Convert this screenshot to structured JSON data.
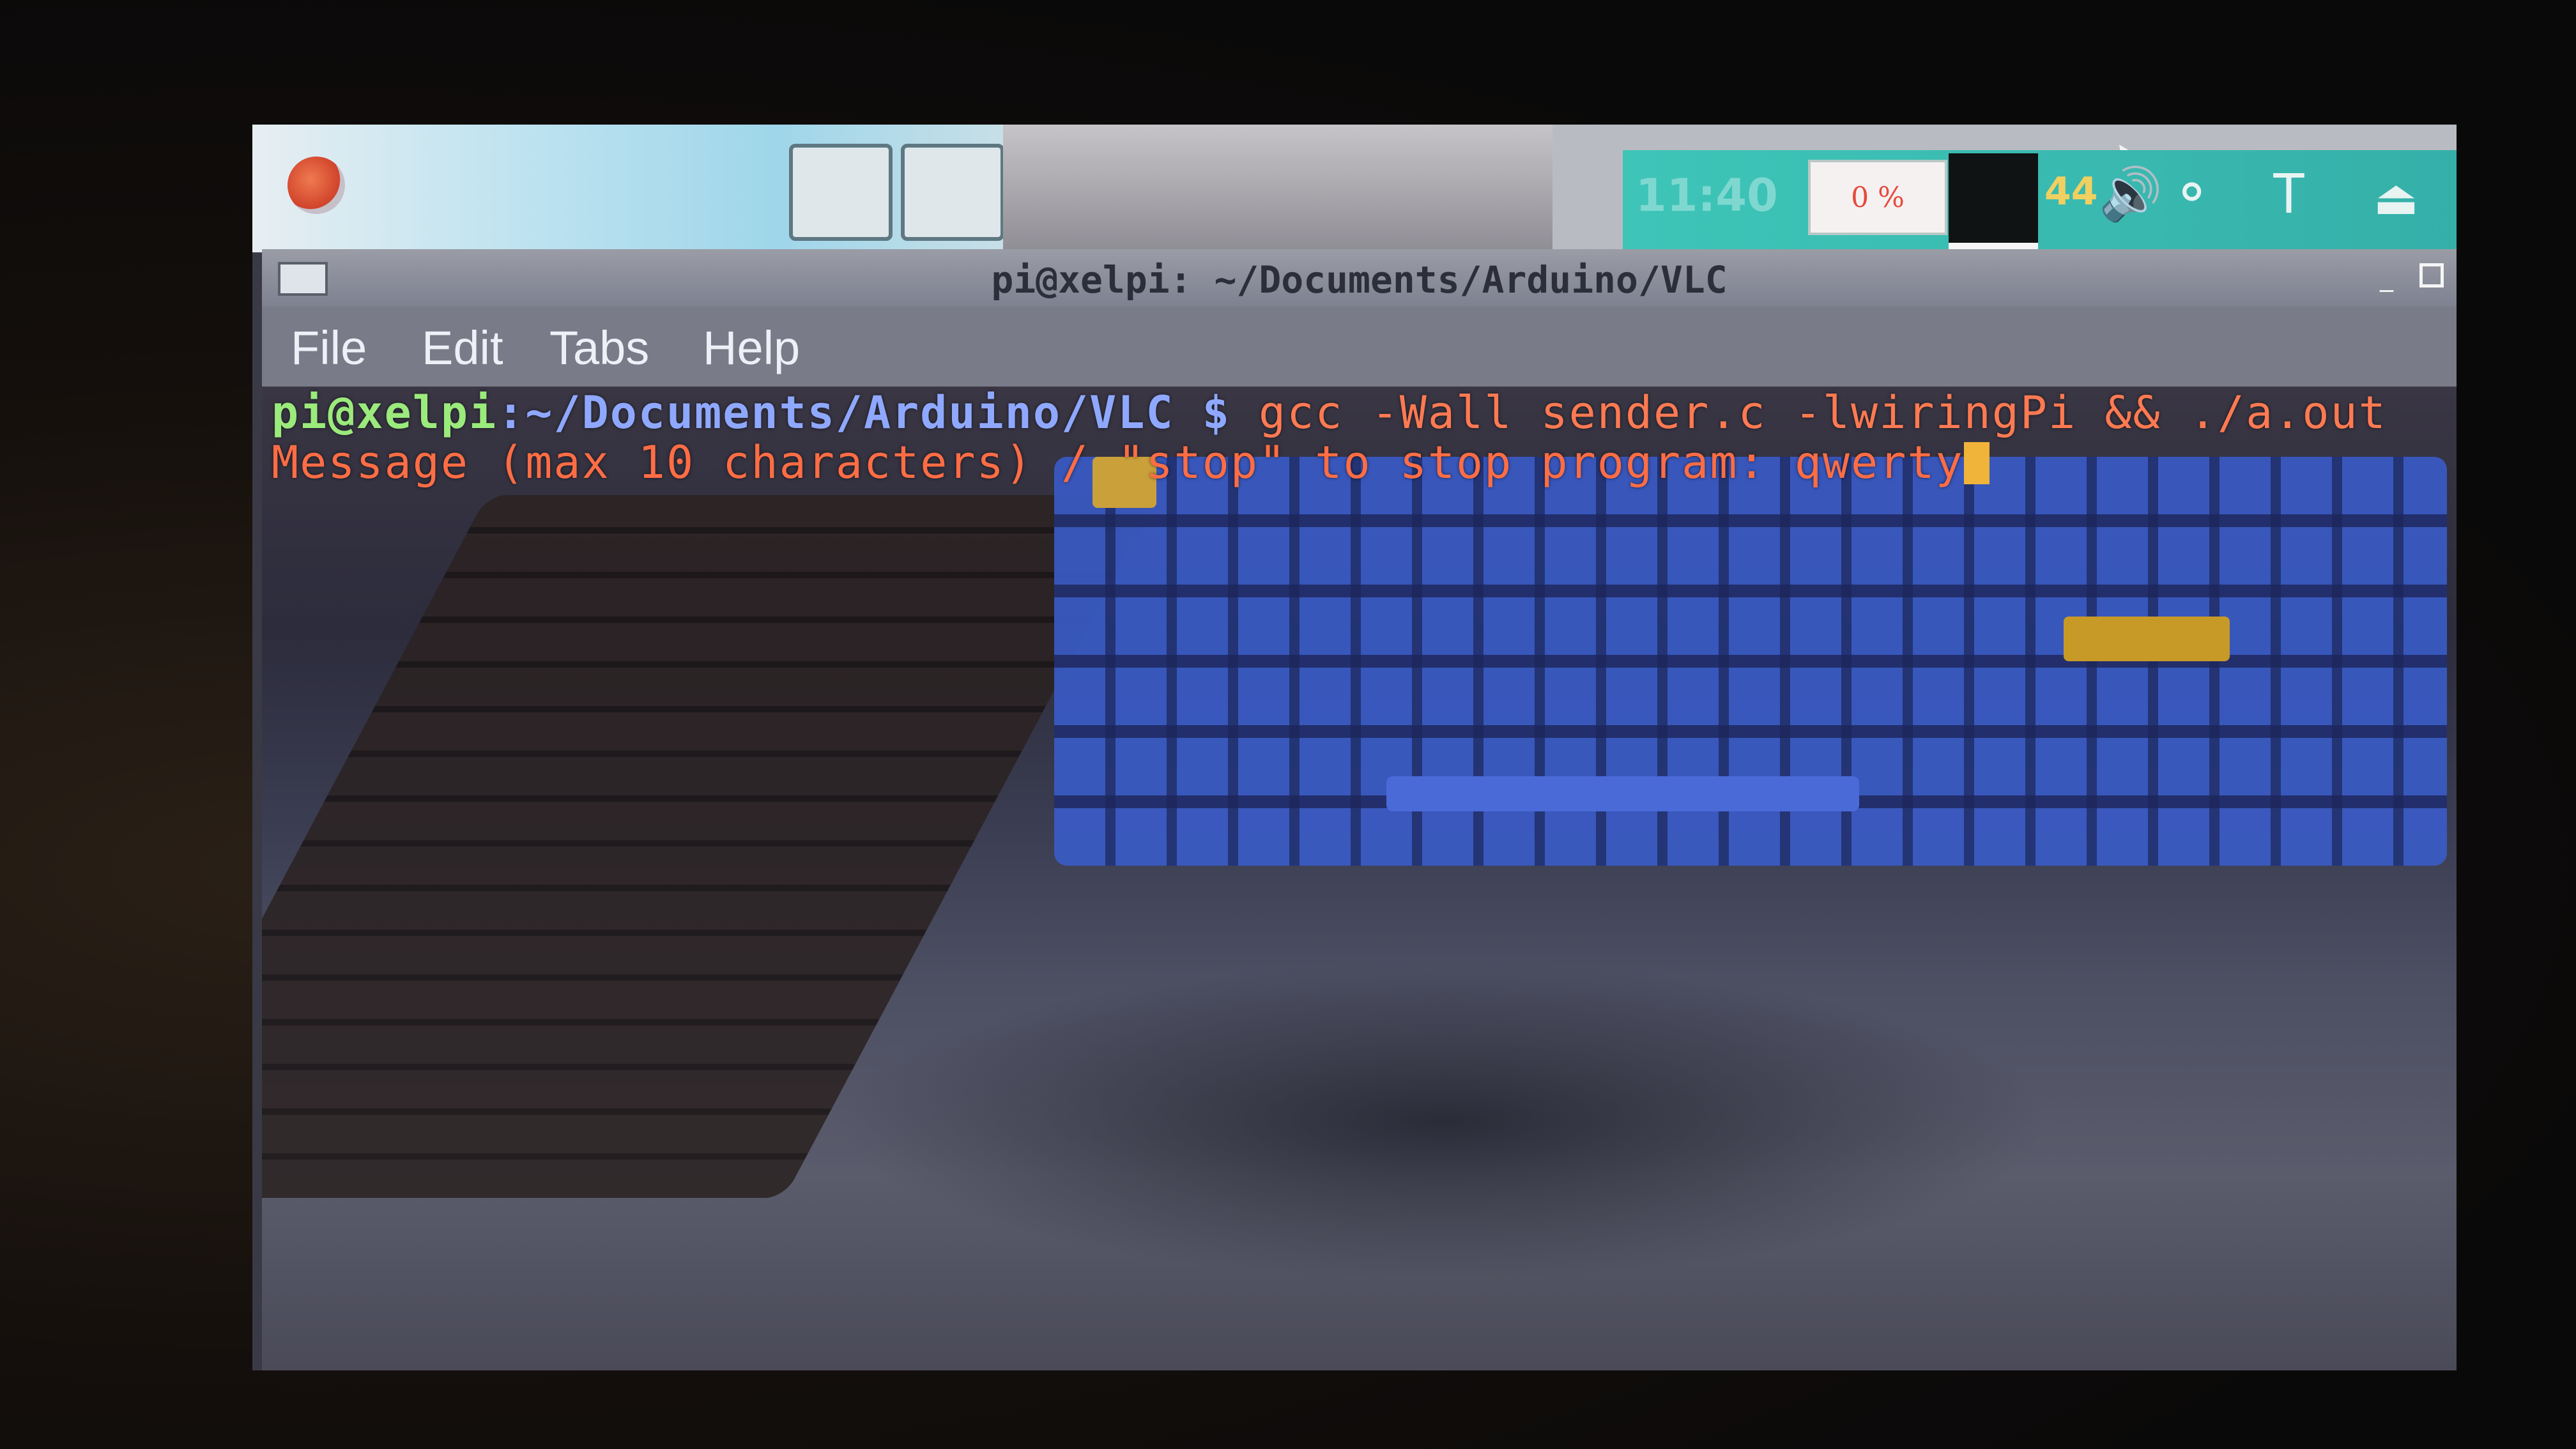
{
  "panel": {
    "launchers": [
      "",
      ""
    ],
    "clock": "11:40",
    "cpu_usage": "0 %",
    "volume_label": "44",
    "icons": [
      "menu-logo",
      "volume-icon",
      "wifi-icon",
      "bluetooth-icon",
      "eject-icon"
    ]
  },
  "window": {
    "title": "pi@xelpi: ~/Documents/Arduino/VLC",
    "menu": {
      "file": "File",
      "edit": "Edit",
      "tabs": "Tabs",
      "help": "Help"
    }
  },
  "terminal": {
    "prompt_user": "pi@xelpi",
    "prompt_path": ":~/Documents/Arduino/VLC",
    "prompt_symbol": " $ ",
    "command": "gcc -Wall sender.c -lwiringPi && ./a.out",
    "output": "Message (max 10 characters) / \"stop\" to stop program: ",
    "input": "qwerty"
  },
  "colors": {
    "prompt_user": "#9bea7c",
    "prompt_path": "#8fa8ff",
    "command": "#ff7a52",
    "cursor": "#f0b43a",
    "tray": "#3ec5b8"
  }
}
